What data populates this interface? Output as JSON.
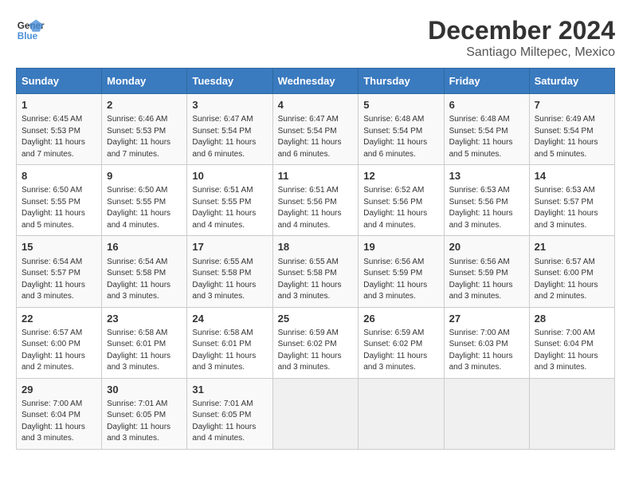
{
  "header": {
    "logo_line1": "General",
    "logo_line2": "Blue",
    "month": "December 2024",
    "location": "Santiago Miltepec, Mexico"
  },
  "days_of_week": [
    "Sunday",
    "Monday",
    "Tuesday",
    "Wednesday",
    "Thursday",
    "Friday",
    "Saturday"
  ],
  "weeks": [
    [
      {
        "day": "1",
        "info": "Sunrise: 6:45 AM\nSunset: 5:53 PM\nDaylight: 11 hours and 7 minutes."
      },
      {
        "day": "2",
        "info": "Sunrise: 6:46 AM\nSunset: 5:53 PM\nDaylight: 11 hours and 7 minutes."
      },
      {
        "day": "3",
        "info": "Sunrise: 6:47 AM\nSunset: 5:54 PM\nDaylight: 11 hours and 6 minutes."
      },
      {
        "day": "4",
        "info": "Sunrise: 6:47 AM\nSunset: 5:54 PM\nDaylight: 11 hours and 6 minutes."
      },
      {
        "day": "5",
        "info": "Sunrise: 6:48 AM\nSunset: 5:54 PM\nDaylight: 11 hours and 6 minutes."
      },
      {
        "day": "6",
        "info": "Sunrise: 6:48 AM\nSunset: 5:54 PM\nDaylight: 11 hours and 5 minutes."
      },
      {
        "day": "7",
        "info": "Sunrise: 6:49 AM\nSunset: 5:54 PM\nDaylight: 11 hours and 5 minutes."
      }
    ],
    [
      {
        "day": "8",
        "info": "Sunrise: 6:50 AM\nSunset: 5:55 PM\nDaylight: 11 hours and 5 minutes."
      },
      {
        "day": "9",
        "info": "Sunrise: 6:50 AM\nSunset: 5:55 PM\nDaylight: 11 hours and 4 minutes."
      },
      {
        "day": "10",
        "info": "Sunrise: 6:51 AM\nSunset: 5:55 PM\nDaylight: 11 hours and 4 minutes."
      },
      {
        "day": "11",
        "info": "Sunrise: 6:51 AM\nSunset: 5:56 PM\nDaylight: 11 hours and 4 minutes."
      },
      {
        "day": "12",
        "info": "Sunrise: 6:52 AM\nSunset: 5:56 PM\nDaylight: 11 hours and 4 minutes."
      },
      {
        "day": "13",
        "info": "Sunrise: 6:53 AM\nSunset: 5:56 PM\nDaylight: 11 hours and 3 minutes."
      },
      {
        "day": "14",
        "info": "Sunrise: 6:53 AM\nSunset: 5:57 PM\nDaylight: 11 hours and 3 minutes."
      }
    ],
    [
      {
        "day": "15",
        "info": "Sunrise: 6:54 AM\nSunset: 5:57 PM\nDaylight: 11 hours and 3 minutes."
      },
      {
        "day": "16",
        "info": "Sunrise: 6:54 AM\nSunset: 5:58 PM\nDaylight: 11 hours and 3 minutes."
      },
      {
        "day": "17",
        "info": "Sunrise: 6:55 AM\nSunset: 5:58 PM\nDaylight: 11 hours and 3 minutes."
      },
      {
        "day": "18",
        "info": "Sunrise: 6:55 AM\nSunset: 5:58 PM\nDaylight: 11 hours and 3 minutes."
      },
      {
        "day": "19",
        "info": "Sunrise: 6:56 AM\nSunset: 5:59 PM\nDaylight: 11 hours and 3 minutes."
      },
      {
        "day": "20",
        "info": "Sunrise: 6:56 AM\nSunset: 5:59 PM\nDaylight: 11 hours and 3 minutes."
      },
      {
        "day": "21",
        "info": "Sunrise: 6:57 AM\nSunset: 6:00 PM\nDaylight: 11 hours and 2 minutes."
      }
    ],
    [
      {
        "day": "22",
        "info": "Sunrise: 6:57 AM\nSunset: 6:00 PM\nDaylight: 11 hours and 2 minutes."
      },
      {
        "day": "23",
        "info": "Sunrise: 6:58 AM\nSunset: 6:01 PM\nDaylight: 11 hours and 3 minutes."
      },
      {
        "day": "24",
        "info": "Sunrise: 6:58 AM\nSunset: 6:01 PM\nDaylight: 11 hours and 3 minutes."
      },
      {
        "day": "25",
        "info": "Sunrise: 6:59 AM\nSunset: 6:02 PM\nDaylight: 11 hours and 3 minutes."
      },
      {
        "day": "26",
        "info": "Sunrise: 6:59 AM\nSunset: 6:02 PM\nDaylight: 11 hours and 3 minutes."
      },
      {
        "day": "27",
        "info": "Sunrise: 7:00 AM\nSunset: 6:03 PM\nDaylight: 11 hours and 3 minutes."
      },
      {
        "day": "28",
        "info": "Sunrise: 7:00 AM\nSunset: 6:04 PM\nDaylight: 11 hours and 3 minutes."
      }
    ],
    [
      {
        "day": "29",
        "info": "Sunrise: 7:00 AM\nSunset: 6:04 PM\nDaylight: 11 hours and 3 minutes."
      },
      {
        "day": "30",
        "info": "Sunrise: 7:01 AM\nSunset: 6:05 PM\nDaylight: 11 hours and 3 minutes."
      },
      {
        "day": "31",
        "info": "Sunrise: 7:01 AM\nSunset: 6:05 PM\nDaylight: 11 hours and 4 minutes."
      },
      {
        "day": "",
        "info": ""
      },
      {
        "day": "",
        "info": ""
      },
      {
        "day": "",
        "info": ""
      },
      {
        "day": "",
        "info": ""
      }
    ]
  ]
}
